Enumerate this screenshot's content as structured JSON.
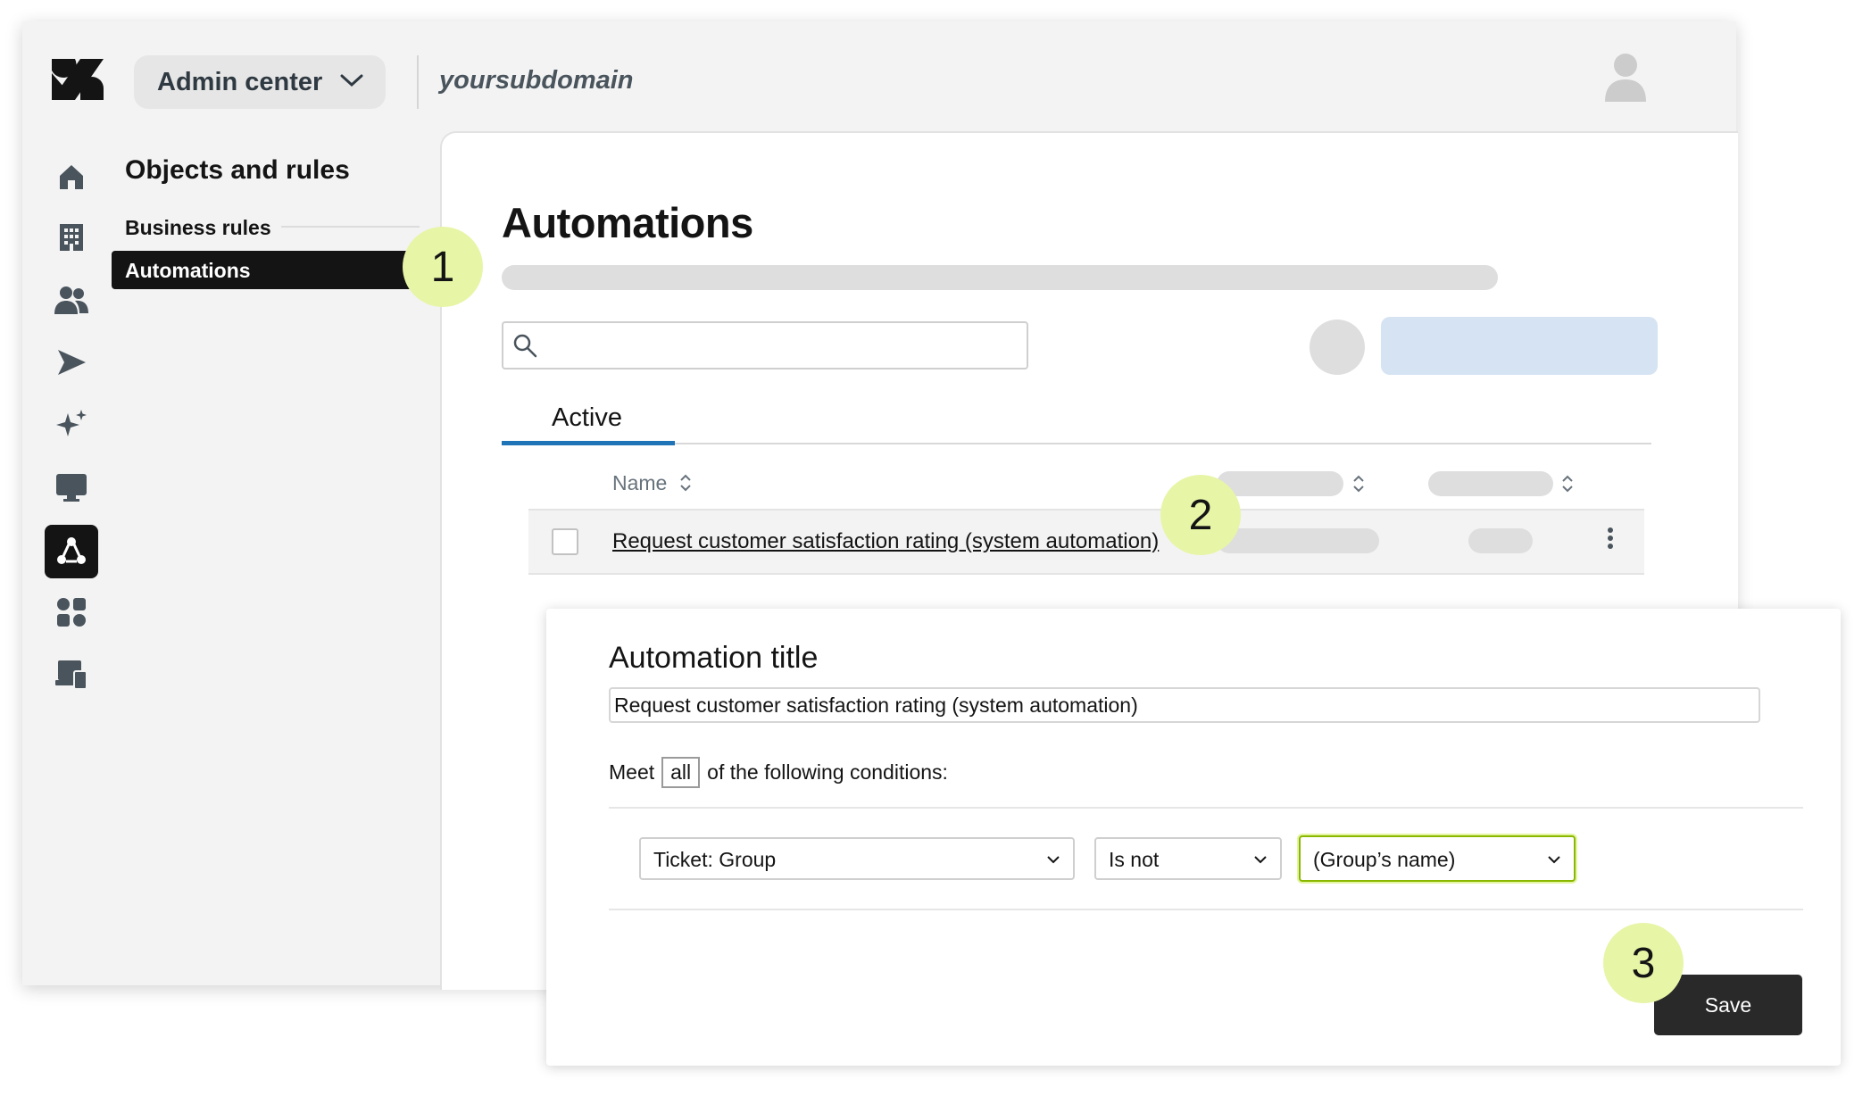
{
  "header": {
    "product_dropdown_label": "Admin center",
    "subdomain": "yoursubdomain"
  },
  "icons": {
    "logo": "zendesk-logo",
    "nav": [
      "home-icon",
      "building-icon",
      "people-icon",
      "send-icon",
      "sparkle-icon",
      "monitor-icon",
      "objects-rules-icon",
      "apps-icon",
      "workspaces-icon"
    ],
    "user": "user-avatar-icon",
    "search": "search-icon"
  },
  "sidebar": {
    "section_title": "Objects and rules",
    "group_label": "Business rules",
    "active_item": "Automations"
  },
  "main": {
    "page_title": "Automations",
    "tabs": [
      {
        "label": "Active"
      }
    ],
    "table": {
      "columns": [
        {
          "label": "Name"
        }
      ],
      "rows": [
        {
          "name": "Request customer satisfaction rating (system automation)"
        }
      ]
    }
  },
  "dialog": {
    "title_label": "Automation title",
    "title_value": "Request customer satisfaction rating (system automation)",
    "conditions_prefix": "Meet",
    "conditions_mode": "all",
    "conditions_suffix": "of the following conditions:",
    "condition": {
      "field": "Ticket: Group",
      "operator": "Is not",
      "value": "(Group’s name)"
    },
    "save_label": "Save"
  },
  "callouts": [
    "1",
    "2",
    "3"
  ],
  "colors": {
    "callout_bg": "#e7f5a7",
    "tab_accent": "#1f73b7",
    "primary_placeholder": "#d6e3f2",
    "selected_bg": "#141414",
    "focus_border": "#8ab800"
  }
}
